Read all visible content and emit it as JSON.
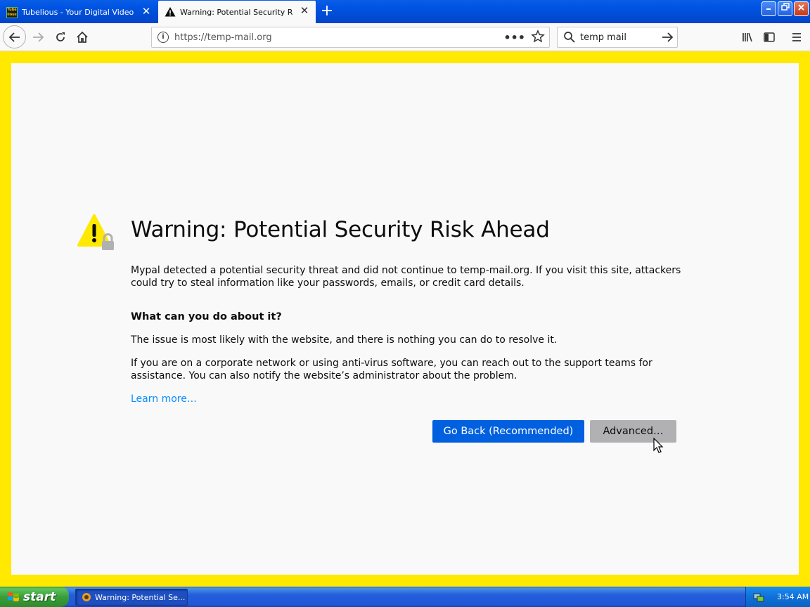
{
  "browser": {
    "tabs": [
      {
        "title": "Tubelious - Your Digital Video Repo",
        "favicon": "tubelious-favicon",
        "active": false
      },
      {
        "title": "Warning: Potential Security Risk Ah",
        "favicon": "warning-icon",
        "active": true
      }
    ],
    "urlbar": {
      "url": "https://temp-mail.org"
    },
    "searchbar": {
      "value": "temp mail"
    }
  },
  "page": {
    "heading": "Warning: Potential Security Risk Ahead",
    "intro": "Mypal detected a potential security threat and did not continue to temp-mail.org. If you visit this site, attackers could try to steal information like your passwords, emails, or credit card details.",
    "what_heading": "What can you do about it?",
    "issue_text": "The issue is most likely with the website, and there is nothing you can do to resolve it.",
    "corp_text": "If you are on a corporate network or using anti-virus software, you can reach out to the support teams for assistance. You can also notify the website’s administrator about the problem.",
    "learn_more": "Learn more…",
    "go_back_label": "Go Back (Recommended)",
    "advanced_label": "Advanced…"
  },
  "taskbar": {
    "start_label": "start",
    "task_item": "Warning: Potential Se...",
    "clock": "3:54 AM"
  },
  "colors": {
    "accent": "#0060df",
    "border_warning": "#ffe900",
    "link": "#0a8dff"
  }
}
